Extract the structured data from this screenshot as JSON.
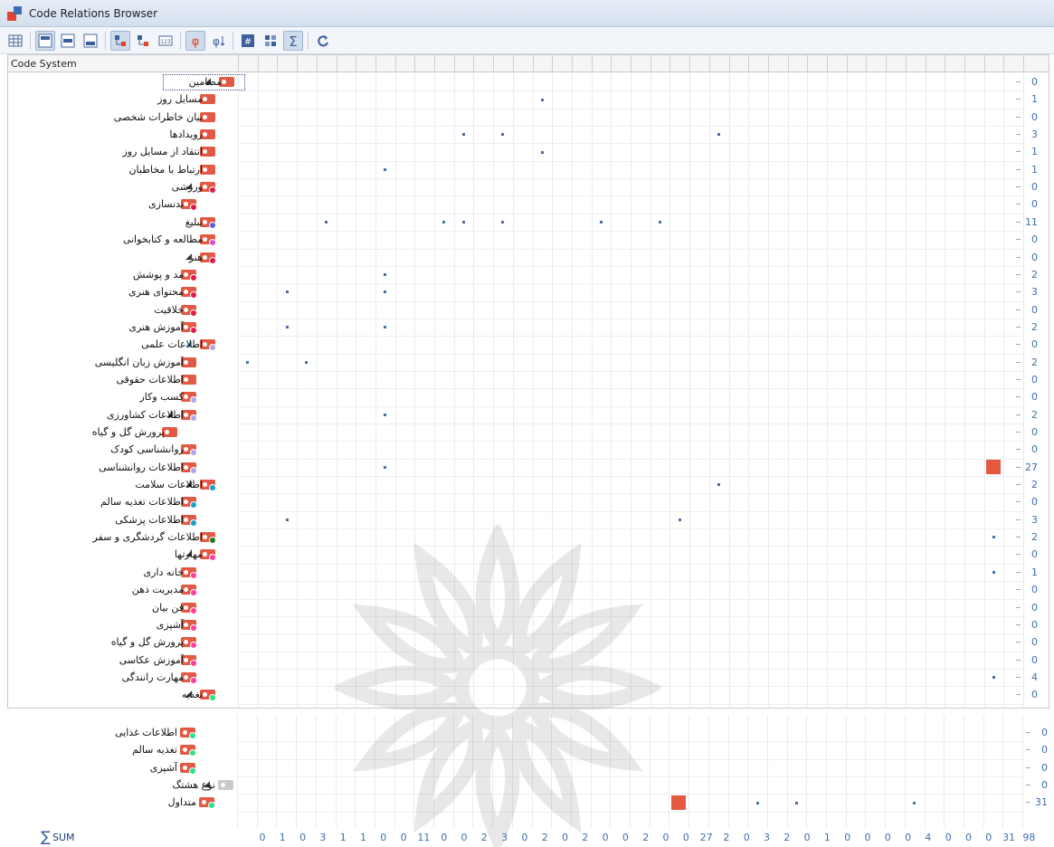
{
  "window": {
    "title": "Code Relations Browser"
  },
  "toolbar": {
    "buttons": [
      {
        "icon": "grid-icon",
        "active": false
      },
      {
        "icon": "align-top-icon",
        "active": true
      },
      {
        "icon": "align-middle-icon",
        "active": false
      },
      {
        "icon": "align-bottom-icon",
        "active": false
      },
      {
        "icon": "code-tree-active-icon",
        "active": true
      },
      {
        "icon": "code-tree-icon",
        "active": false
      },
      {
        "icon": "number-box-icon",
        "active": false
      },
      {
        "icon": "phi-icon",
        "active": true
      },
      {
        "icon": "phi-sort-icon",
        "active": false
      },
      {
        "icon": "hash-icon",
        "active": false
      },
      {
        "icon": "matrix-icon",
        "active": false
      },
      {
        "icon": "sigma-icon",
        "active": true
      },
      {
        "icon": "refresh-icon",
        "active": false
      }
    ]
  },
  "header": {
    "label": "Code System"
  },
  "tree": [
    {
      "label": "مضامین",
      "depth": 0,
      "arrow": "◢",
      "icon": "red",
      "dot": "",
      "sum": "0",
      "selected": true
    },
    {
      "label": "مسایل روز",
      "depth": 1,
      "arrow": "",
      "icon": "red",
      "dot": "",
      "sum": "1",
      "selected": false
    },
    {
      "label": "بیان خاطرات شخصی",
      "depth": 1,
      "arrow": "",
      "icon": "red",
      "dot": "",
      "sum": "0",
      "selected": false
    },
    {
      "label": "رویدادها",
      "depth": 1,
      "arrow": "",
      "icon": "red",
      "dot": "",
      "sum": "3",
      "selected": false
    },
    {
      "label": "انتقاد از مسایل روز",
      "depth": 1,
      "arrow": "",
      "icon": "red",
      "dot": "",
      "sum": "1",
      "selected": false
    },
    {
      "label": "ارتباط با مخاطبان",
      "depth": 1,
      "arrow": "",
      "icon": "red",
      "dot": "",
      "sum": "1",
      "selected": false
    },
    {
      "label": "ورزشی",
      "depth": 1,
      "arrow": "◢",
      "icon": "red",
      "dot": "#e8174a",
      "sum": "0",
      "selected": false
    },
    {
      "label": "بدنسازی",
      "depth": 2,
      "arrow": "",
      "icon": "red",
      "dot": "#e8174a",
      "sum": "0",
      "selected": false
    },
    {
      "label": "تبلیغ",
      "depth": 1,
      "arrow": "",
      "icon": "red",
      "dot": "#5b5cf0",
      "sum": "11",
      "selected": false
    },
    {
      "label": "مطالعه و کتابخوانی",
      "depth": 1,
      "arrow": "",
      "icon": "red",
      "dot": "#d94fd0",
      "sum": "0",
      "selected": false
    },
    {
      "label": "هنر",
      "depth": 1,
      "arrow": "◢",
      "icon": "red",
      "dot": "#e8174a",
      "sum": "0",
      "selected": false
    },
    {
      "label": "مد و پوشش",
      "depth": 2,
      "arrow": "",
      "icon": "red",
      "dot": "#e8174a",
      "sum": "2",
      "selected": false
    },
    {
      "label": "محتوای هنری",
      "depth": 2,
      "arrow": "",
      "icon": "red",
      "dot": "#e8174a",
      "sum": "3",
      "selected": false
    },
    {
      "label": "خلاقیت",
      "depth": 2,
      "arrow": "",
      "icon": "red",
      "dot": "#e8174a",
      "sum": "0",
      "selected": false
    },
    {
      "label": "آموزش هنری",
      "depth": 2,
      "arrow": "",
      "icon": "red",
      "dot": "#e8174a",
      "sum": "2",
      "selected": false
    },
    {
      "label": "اطلاعات علمی",
      "depth": 1,
      "arrow": "◢",
      "arrowBlue": true,
      "icon": "red",
      "dot": "#b3a3ee",
      "sum": "0",
      "selected": false
    },
    {
      "label": "آموزش زبان انگلیسی",
      "depth": 2,
      "arrow": "",
      "icon": "red",
      "dot": "",
      "sum": "2",
      "selected": false
    },
    {
      "label": "اطلاعات حقوقی",
      "depth": 2,
      "arrow": "",
      "icon": "red",
      "dot": "",
      "sum": "0",
      "selected": false
    },
    {
      "label": "کسب وکار",
      "depth": 2,
      "arrow": "",
      "icon": "red",
      "dot": "#b3a3ee",
      "sum": "0",
      "selected": false
    },
    {
      "label": "اطلاعات کشاورزی",
      "depth": 2,
      "arrow": "◢",
      "icon": "red",
      "dot": "#b3a3ee",
      "sum": "2",
      "selected": false
    },
    {
      "label": "پرورش گل و گیاه",
      "depth": 3,
      "arrow": "",
      "icon": "red",
      "dot": "",
      "sum": "0",
      "selected": false
    },
    {
      "label": "روانشناسی کودک",
      "depth": 2,
      "arrow": "",
      "icon": "red",
      "dot": "#b3a3ee",
      "sum": "0",
      "selected": false
    },
    {
      "label": "اطلاعات روانشناسی",
      "depth": 2,
      "arrow": "",
      "icon": "red",
      "dot": "#b3a3ee",
      "sum": "27",
      "selected": false
    },
    {
      "label": "اطلاعات سلامت",
      "depth": 1,
      "arrow": "◢",
      "icon": "red",
      "dot": "#1aa0c8",
      "sum": "2",
      "selected": false
    },
    {
      "label": "اطلاعات تغذیه سالم",
      "depth": 2,
      "arrow": "",
      "icon": "red",
      "dot": "#1aa0c8",
      "sum": "0",
      "selected": false
    },
    {
      "label": "اطلاعات پزشکی",
      "depth": 2,
      "arrow": "",
      "icon": "red",
      "dot": "#1aa0c8",
      "sum": "3",
      "selected": false
    },
    {
      "label": "اطلاعات گردشگری و سفر",
      "depth": 1,
      "arrow": "",
      "icon": "red",
      "dot": "#1d7a1d",
      "sum": "2",
      "selected": false
    },
    {
      "label": "مهارتها",
      "depth": 1,
      "arrow": "◢",
      "icon": "red",
      "dot": "#ff3f9b",
      "sum": "0",
      "selected": false
    },
    {
      "label": "خانه داری",
      "depth": 2,
      "arrow": "",
      "icon": "red",
      "dot": "#ff3f9b",
      "sum": "1",
      "selected": false
    },
    {
      "label": "مدیریت ذهن",
      "depth": 2,
      "arrow": "",
      "icon": "red",
      "dot": "#ff3f9b",
      "sum": "0",
      "selected": false
    },
    {
      "label": "فن بیان",
      "depth": 2,
      "arrow": "",
      "icon": "red",
      "dot": "#ff3f9b",
      "sum": "0",
      "selected": false
    },
    {
      "label": "آشپزی",
      "depth": 2,
      "arrow": "",
      "icon": "red",
      "dot": "#ff3f9b",
      "sum": "0",
      "selected": false
    },
    {
      "label": "پرورش گل و گیاه",
      "depth": 2,
      "arrow": "",
      "icon": "red",
      "dot": "#ff3f9b",
      "sum": "0",
      "selected": false
    },
    {
      "label": "آموزش عکاسی",
      "depth": 2,
      "arrow": "",
      "icon": "red",
      "dot": "#ff3f9b",
      "sum": "0",
      "selected": false
    },
    {
      "label": "مهارت رانندگی",
      "depth": 2,
      "arrow": "",
      "icon": "red",
      "dot": "#ff3f9b",
      "sum": "4",
      "selected": false
    },
    {
      "label": "تغذیه",
      "depth": 1,
      "arrow": "◢",
      "icon": "red",
      "dot": "#2de08a",
      "sum": "0",
      "selected": false
    }
  ],
  "tree_bottom": [
    {
      "label": "اطلاعات غذایی",
      "depth": 2,
      "arrow": "",
      "icon": "red",
      "dot": "#2de08a",
      "sum": "0"
    },
    {
      "label": "تغذیه سالم",
      "depth": 2,
      "arrow": "",
      "icon": "red",
      "dot": "#2de08a",
      "sum": "0"
    },
    {
      "label": "آشپزی",
      "depth": 2,
      "arrow": "",
      "icon": "red",
      "dot": "#2de08a",
      "sum": "0"
    },
    {
      "label": "نوع هشتگ",
      "depth": 0,
      "arrow": "◢",
      "icon": "grey",
      "dot": "",
      "sum": "0"
    },
    {
      "label": "متداول",
      "depth": 1,
      "arrow": "",
      "icon": "red",
      "dot": "#2de08a",
      "sum": "31"
    }
  ],
  "matrix_cells": [
    {
      "row": 1,
      "col": 28,
      "size": 2
    },
    {
      "row": 3,
      "col": 24,
      "size": 2
    },
    {
      "row": 3,
      "col": 26,
      "size": 2
    },
    {
      "row": 3,
      "col": 37,
      "size": 2
    },
    {
      "row": 4,
      "col": 28,
      "size": 2
    },
    {
      "row": 5,
      "col": 20,
      "size": 2
    },
    {
      "row": 8,
      "col": 17,
      "size": 2
    },
    {
      "row": 8,
      "col": 23,
      "size": 2
    },
    {
      "row": 8,
      "col": 24,
      "size": 2
    },
    {
      "row": 8,
      "col": 26,
      "size": 2
    },
    {
      "row": 8,
      "col": 31,
      "size": 2
    },
    {
      "row": 8,
      "col": 34,
      "size": 2
    },
    {
      "row": 11,
      "col": 20,
      "size": 2
    },
    {
      "row": 12,
      "col": 15,
      "size": 2
    },
    {
      "row": 12,
      "col": 20,
      "size": 2
    },
    {
      "row": 14,
      "col": 15,
      "size": 2
    },
    {
      "row": 14,
      "col": 20,
      "size": 2
    },
    {
      "row": 16,
      "col": 13,
      "size": 2
    },
    {
      "row": 16,
      "col": 16,
      "size": 2
    },
    {
      "row": 19,
      "col": 20,
      "size": 2
    },
    {
      "row": 22,
      "col": 20,
      "size": 2
    },
    {
      "row": 22,
      "col": 51,
      "size": 14,
      "color": "red"
    },
    {
      "row": 23,
      "col": 37,
      "size": 2
    },
    {
      "row": 25,
      "col": 15,
      "size": 2
    },
    {
      "row": 25,
      "col": 35,
      "size": 2
    },
    {
      "row": 26,
      "col": 51,
      "size": 2
    },
    {
      "row": 28,
      "col": 51,
      "size": 2
    },
    {
      "row": 34,
      "col": 51,
      "size": 2
    }
  ],
  "matrix_cells_bottom": [
    {
      "row": 4,
      "col": 35,
      "size": 14,
      "color": "red"
    },
    {
      "row": 4,
      "col": 39,
      "size": 2
    },
    {
      "row": 4,
      "col": 41,
      "size": 2
    },
    {
      "row": 4,
      "col": 47,
      "size": 2
    }
  ],
  "sum_row": {
    "label": "SUM",
    "values": [
      "0",
      "1",
      "0",
      "3",
      "1",
      "1",
      "0",
      "0",
      "11",
      "0",
      "0",
      "2",
      "3",
      "0",
      "2",
      "0",
      "2",
      "0",
      "0",
      "2",
      "0",
      "0",
      "27",
      "2",
      "0",
      "3",
      "2",
      "0",
      "1",
      "0",
      "0",
      "0",
      "0",
      "4",
      "0",
      "0",
      "0",
      "31",
      "98"
    ]
  }
}
